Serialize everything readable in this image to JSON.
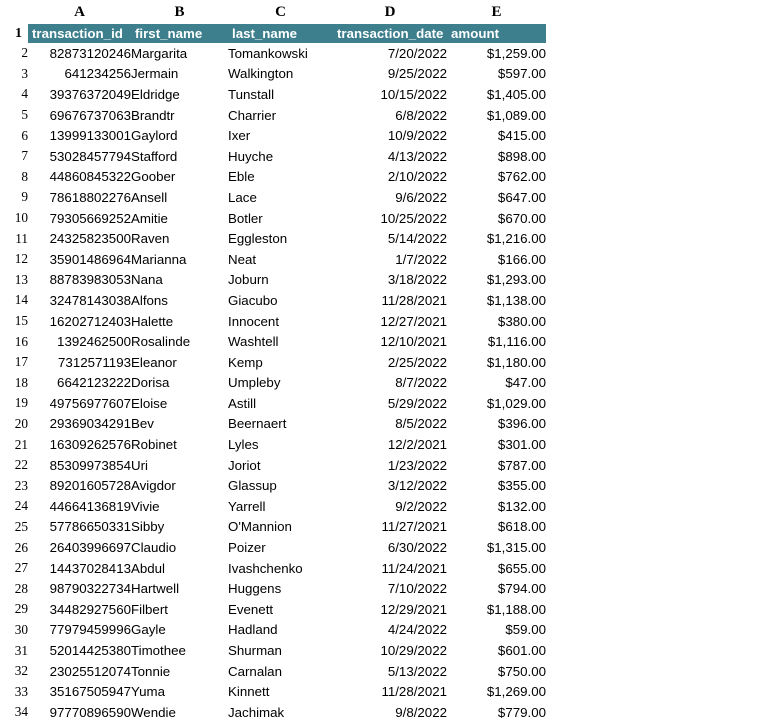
{
  "spreadsheet": {
    "column_letters": [
      "A",
      "B",
      "C",
      "D",
      "E"
    ],
    "headers": {
      "a": "transaction_id",
      "b": "first_name",
      "c": "last_name",
      "d": "transaction_date",
      "e": "amount"
    },
    "header_row_number": "1",
    "header_fill_color": "#3d7f8c",
    "header_text_color": "#ffffff",
    "rows": [
      {
        "n": "2",
        "transaction_id": "82873120246",
        "first_name": "Margarita",
        "last_name": "Tomankowski",
        "transaction_date": "7/20/2022",
        "amount": "$1,259.00"
      },
      {
        "n": "3",
        "transaction_id": "641234256",
        "first_name": "Jermain",
        "last_name": "Walkington",
        "transaction_date": "9/25/2022",
        "amount": "$597.00"
      },
      {
        "n": "4",
        "transaction_id": "39376372049",
        "first_name": "Eldridge",
        "last_name": "Tunstall",
        "transaction_date": "10/15/2022",
        "amount": "$1,405.00"
      },
      {
        "n": "5",
        "transaction_id": "69676737063",
        "first_name": "Brandtr",
        "last_name": "Charrier",
        "transaction_date": "6/8/2022",
        "amount": "$1,089.00"
      },
      {
        "n": "6",
        "transaction_id": "13999133001",
        "first_name": "Gaylord",
        "last_name": "Ixer",
        "transaction_date": "10/9/2022",
        "amount": "$415.00"
      },
      {
        "n": "7",
        "transaction_id": "53028457794",
        "first_name": "Stafford",
        "last_name": "Huyche",
        "transaction_date": "4/13/2022",
        "amount": "$898.00"
      },
      {
        "n": "8",
        "transaction_id": "44860845322",
        "first_name": "Goober",
        "last_name": "Eble",
        "transaction_date": "2/10/2022",
        "amount": "$762.00"
      },
      {
        "n": "9",
        "transaction_id": "78618802276",
        "first_name": "Ansell",
        "last_name": "Lace",
        "transaction_date": "9/6/2022",
        "amount": "$647.00"
      },
      {
        "n": "10",
        "transaction_id": "79305669252",
        "first_name": "Amitie",
        "last_name": "Botler",
        "transaction_date": "10/25/2022",
        "amount": "$670.00"
      },
      {
        "n": "11",
        "transaction_id": "24325823500",
        "first_name": "Raven",
        "last_name": "Eggleston",
        "transaction_date": "5/14/2022",
        "amount": "$1,216.00"
      },
      {
        "n": "12",
        "transaction_id": "35901486964",
        "first_name": "Marianna",
        "last_name": "Neat",
        "transaction_date": "1/7/2022",
        "amount": "$166.00"
      },
      {
        "n": "13",
        "transaction_id": "88783983053",
        "first_name": "Nana",
        "last_name": "Joburn",
        "transaction_date": "3/18/2022",
        "amount": "$1,293.00"
      },
      {
        "n": "14",
        "transaction_id": "32478143038",
        "first_name": "Alfons",
        "last_name": "Giacubo",
        "transaction_date": "11/28/2021",
        "amount": "$1,138.00"
      },
      {
        "n": "15",
        "transaction_id": "16202712403",
        "first_name": "Halette",
        "last_name": "Innocent",
        "transaction_date": "12/27/2021",
        "amount": "$380.00"
      },
      {
        "n": "16",
        "transaction_id": "1392462500",
        "first_name": "Rosalinde",
        "last_name": "Washtell",
        "transaction_date": "12/10/2021",
        "amount": "$1,116.00"
      },
      {
        "n": "17",
        "transaction_id": "7312571193",
        "first_name": "Eleanor",
        "last_name": "Kemp",
        "transaction_date": "2/25/2022",
        "amount": "$1,180.00"
      },
      {
        "n": "18",
        "transaction_id": "6642123222",
        "first_name": "Dorisa",
        "last_name": "Umpleby",
        "transaction_date": "8/7/2022",
        "amount": "$47.00"
      },
      {
        "n": "19",
        "transaction_id": "49756977607",
        "first_name": "Eloise",
        "last_name": "Astill",
        "transaction_date": "5/29/2022",
        "amount": "$1,029.00"
      },
      {
        "n": "20",
        "transaction_id": "29369034291",
        "first_name": "Bev",
        "last_name": "Beernaert",
        "transaction_date": "8/5/2022",
        "amount": "$396.00"
      },
      {
        "n": "21",
        "transaction_id": "16309262576",
        "first_name": "Robinet",
        "last_name": "Lyles",
        "transaction_date": "12/2/2021",
        "amount": "$301.00"
      },
      {
        "n": "22",
        "transaction_id": "85309973854",
        "first_name": "Uri",
        "last_name": "Joriot",
        "transaction_date": "1/23/2022",
        "amount": "$787.00"
      },
      {
        "n": "23",
        "transaction_id": "89201605728",
        "first_name": "Avigdor",
        "last_name": "Glassup",
        "transaction_date": "3/12/2022",
        "amount": "$355.00"
      },
      {
        "n": "24",
        "transaction_id": "44664136819",
        "first_name": "Vivie",
        "last_name": "Yarrell",
        "transaction_date": "9/2/2022",
        "amount": "$132.00"
      },
      {
        "n": "25",
        "transaction_id": "57786650331",
        "first_name": "Sibby",
        "last_name": "O'Mannion",
        "transaction_date": "11/27/2021",
        "amount": "$618.00"
      },
      {
        "n": "26",
        "transaction_id": "26403996697",
        "first_name": "Claudio",
        "last_name": "Poizer",
        "transaction_date": "6/30/2022",
        "amount": "$1,315.00"
      },
      {
        "n": "27",
        "transaction_id": "14437028413",
        "first_name": "Abdul",
        "last_name": "Ivashchenko",
        "transaction_date": "11/24/2021",
        "amount": "$655.00"
      },
      {
        "n": "28",
        "transaction_id": "98790322734",
        "first_name": "Hartwell",
        "last_name": "Huggens",
        "transaction_date": "7/10/2022",
        "amount": "$794.00"
      },
      {
        "n": "29",
        "transaction_id": "34482927560",
        "first_name": "Filbert",
        "last_name": "Evenett",
        "transaction_date": "12/29/2021",
        "amount": "$1,188.00"
      },
      {
        "n": "30",
        "transaction_id": "77979459996",
        "first_name": "Gayle",
        "last_name": "Hadland",
        "transaction_date": "4/24/2022",
        "amount": "$59.00"
      },
      {
        "n": "31",
        "transaction_id": "52014425380",
        "first_name": "Timothee",
        "last_name": "Shurman",
        "transaction_date": "10/29/2022",
        "amount": "$601.00"
      },
      {
        "n": "32",
        "transaction_id": "23025512074",
        "first_name": "Tonnie",
        "last_name": "Carnalan",
        "transaction_date": "5/13/2022",
        "amount": "$750.00"
      },
      {
        "n": "33",
        "transaction_id": "35167505947",
        "first_name": "Yuma",
        "last_name": "Kinnett",
        "transaction_date": "11/28/2021",
        "amount": "$1,269.00"
      },
      {
        "n": "34",
        "transaction_id": "97770896590",
        "first_name": "Wendie",
        "last_name": "Jachimak",
        "transaction_date": "9/8/2022",
        "amount": "$779.00"
      }
    ]
  }
}
